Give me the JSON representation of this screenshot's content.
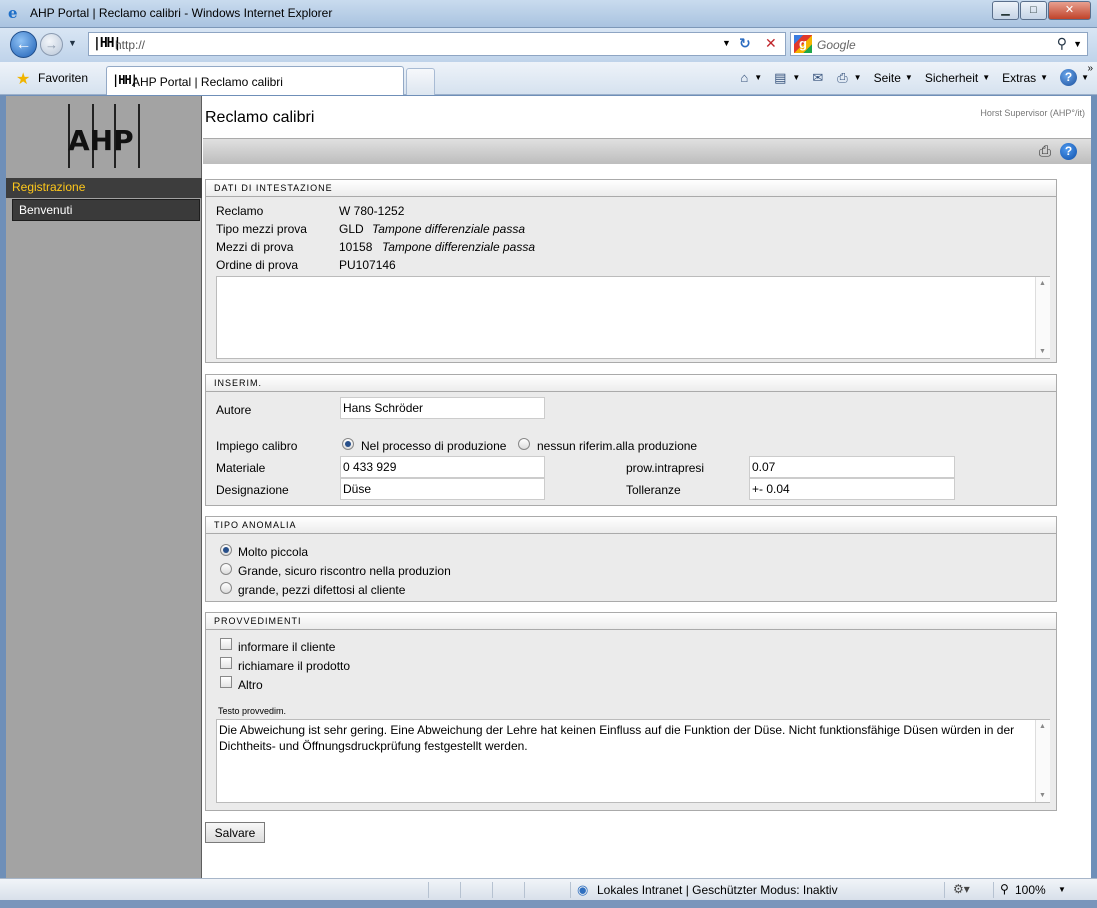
{
  "window": {
    "title": "AHP Portal | Reclamo calibri - Windows Internet Explorer",
    "minimize": "▁",
    "maximize": "□",
    "close": "✕"
  },
  "address": {
    "logo": "|ΗH|",
    "url": "http://",
    "search_placeholder": "Google"
  },
  "favbar": {
    "favorites_label": "Favoriten",
    "tab_logo": "|ΗH|",
    "tab_title": "AHP Portal | Reclamo calibri",
    "page_menu": "Seite",
    "security_menu": "Sicherheit",
    "extras_menu": "Extras"
  },
  "sidebar": {
    "logo_text": "AHP",
    "section": "Registrazione",
    "items": [
      {
        "label": "Benvenuti"
      }
    ]
  },
  "page": {
    "title": "Reclamo calibri",
    "user": "Horst Supervisor (AHP°/it)"
  },
  "header_section": {
    "title": "DATI DI INTESTAZIONE",
    "rows": [
      {
        "label": "Reclamo",
        "code": "W 780-1252",
        "desc": ""
      },
      {
        "label": "Tipo mezzi prova",
        "code": "GLD",
        "desc": "Tampone differenziale passa"
      },
      {
        "label": "Mezzi di prova",
        "code": "10158",
        "desc": "Tampone differenziale passa"
      },
      {
        "label": "Ordine di prova",
        "code": "PU107146",
        "desc": ""
      }
    ],
    "notes": ""
  },
  "insert_section": {
    "title": "INSERIM.",
    "author_label": "Autore",
    "author_value": "Hans Schröder",
    "usage_label": "Impiego calibro",
    "usage_options": [
      {
        "label": "Nel processo di produzione",
        "selected": true
      },
      {
        "label": "nessun riferim.alla produzione",
        "selected": false
      }
    ],
    "material_label": "Materiale",
    "material_value": "0 433 929",
    "designation_label": "Designazione",
    "designation_value": "Düse",
    "tests_label": "prow.intrapresi",
    "tests_value": "0.07",
    "tolerance_label": "Tolleranze",
    "tolerance_value": "+- 0.04"
  },
  "anomaly_section": {
    "title": "TIPO ANOMALIA",
    "options": [
      {
        "label": "Molto piccola",
        "selected": true
      },
      {
        "label": "Grande, sicuro riscontro nella produzion",
        "selected": false
      },
      {
        "label": "grande, pezzi difettosi al cliente",
        "selected": false
      }
    ]
  },
  "measures_section": {
    "title": "PROVVEDIMENTI",
    "checks": [
      {
        "label": "informare il cliente",
        "checked": false
      },
      {
        "label": "richiamare il prodotto",
        "checked": false
      },
      {
        "label": "Altro",
        "checked": false
      }
    ],
    "text_label": "Testo provvedim.",
    "text_value": "Die Abweichung ist sehr gering. Eine Abweichung der Lehre hat keinen Einfluss auf die Funktion der Düse. Nicht funktionsfähige Düsen würden in der Dichtheits- und Öffnungsdruckprüfung festgestellt werden."
  },
  "save_label": "Salvare",
  "status": {
    "zone": "Lokales Intranet | Geschützter Modus: Inaktiv",
    "zoom": "100%"
  }
}
